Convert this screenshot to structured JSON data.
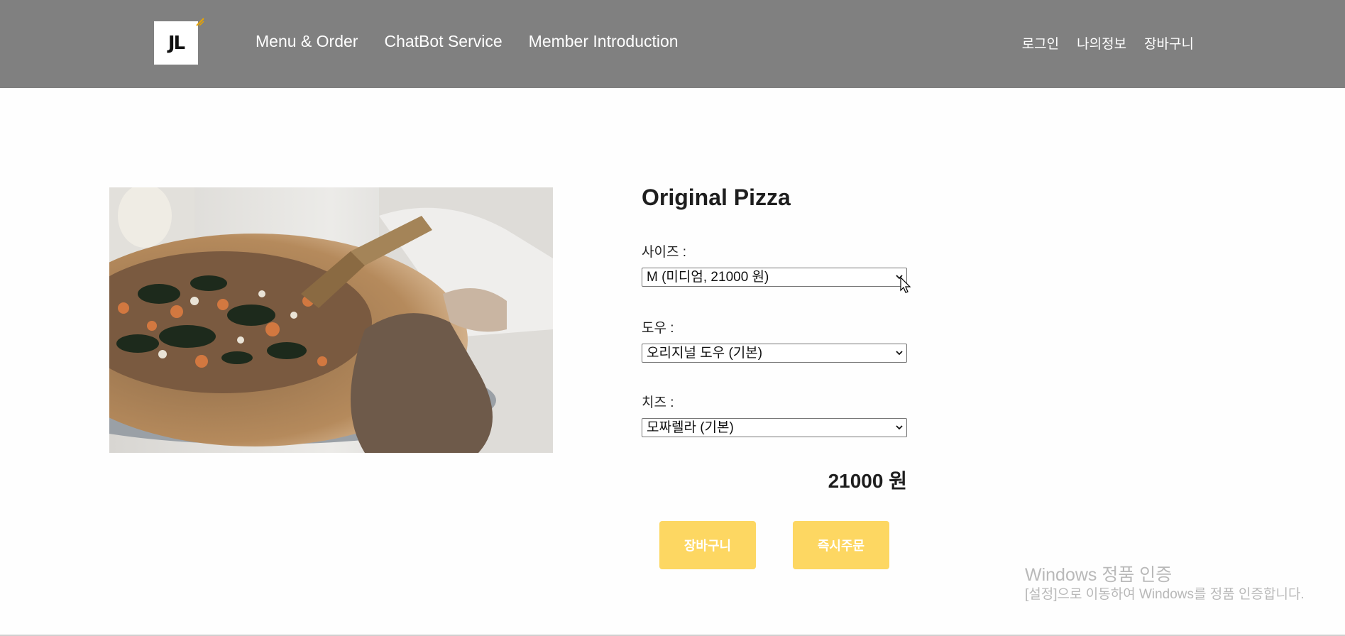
{
  "header": {
    "logo_text": "JL",
    "nav": [
      "Menu & Order",
      "ChatBot Service",
      "Member Introduction"
    ],
    "util": [
      "로그인",
      "나의정보",
      "장바구니"
    ]
  },
  "product": {
    "name": "Original Pizza",
    "size_label": "사이즈 :",
    "size_value": "M (미디엄, 21000 원)",
    "dough_label": "도우 :",
    "dough_value": "오리지널 도우 (기본)",
    "cheese_label": "치즈 :",
    "cheese_value": "모짜렐라 (기본)",
    "price": "21000 원"
  },
  "buttons": {
    "cart": "장바구니",
    "order_now": "즉시주문"
  },
  "watermark": {
    "line1": "Windows 정품 인증",
    "line2": "[설정]으로 이동하여 Windows를 정품 인증합니다."
  },
  "colors": {
    "header_bg": "#808080",
    "button_bg": "#fdd762"
  }
}
